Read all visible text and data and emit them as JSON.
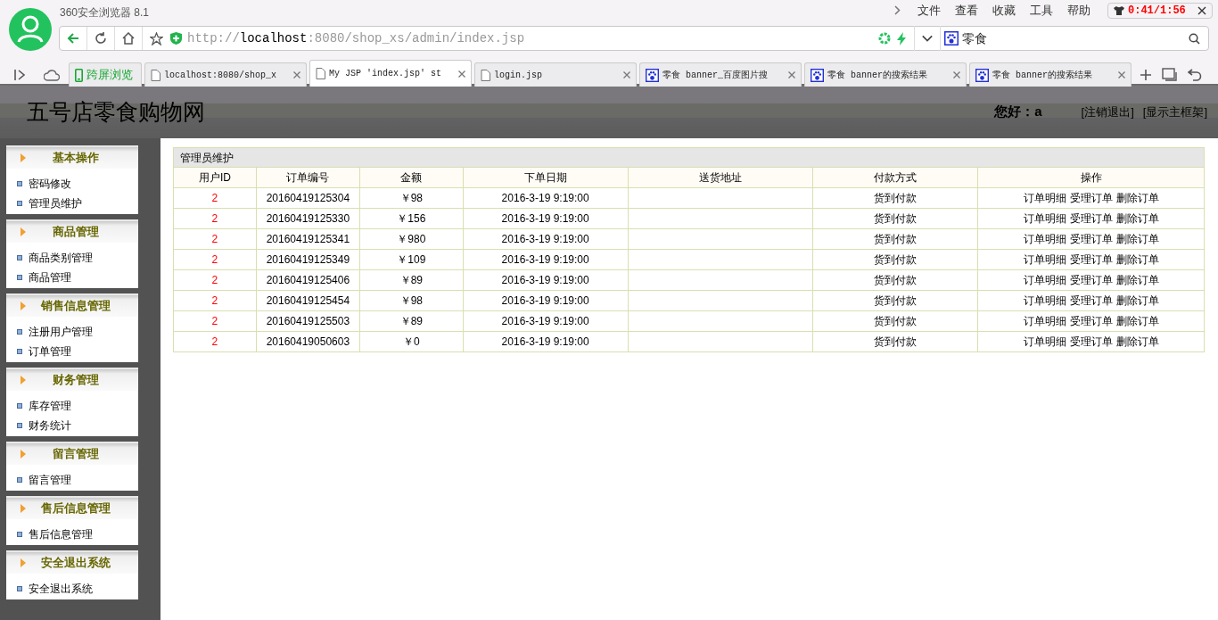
{
  "browser": {
    "app_title": "360安全浏览器 8.1",
    "menu": [
      "文件",
      "查看",
      "收藏",
      "工具",
      "帮助"
    ],
    "timer_overlay": "0:41/1:56",
    "address": {
      "scheme": "http://",
      "host": "localhost",
      "rest": ":8080/shop_xs/admin/index.jsp"
    },
    "search": {
      "value": "零食"
    },
    "tabs": [
      {
        "kind": "cross",
        "label": "跨屏浏览",
        "selected": false
      },
      {
        "kind": "page",
        "label": "localhost:8080/shop_x",
        "selected": false
      },
      {
        "kind": "page",
        "label": "My JSP 'index.jsp' st",
        "selected": true
      },
      {
        "kind": "page",
        "label": "login.jsp",
        "selected": false
      },
      {
        "kind": "paw",
        "label": "零食 banner_百度图片搜",
        "selected": false
      },
      {
        "kind": "paw",
        "label": "零食 banner的搜索结果",
        "selected": false
      },
      {
        "kind": "paw",
        "label": "零食 banner的搜索结果",
        "selected": false
      }
    ]
  },
  "header": {
    "site_title": "五号店零食购物网",
    "greeting": "您好：a",
    "links": [
      "[注销退出]",
      "[显示主框架]"
    ]
  },
  "sidebar": [
    {
      "title": "基本操作",
      "items": [
        "密码修改",
        "管理员维护"
      ]
    },
    {
      "title": "商品管理",
      "items": [
        "商品类别管理",
        "商品管理"
      ]
    },
    {
      "title": "销售信息管理",
      "items": [
        "注册用户管理",
        "订单管理"
      ]
    },
    {
      "title": "财务管理",
      "items": [
        "库存管理",
        "财务统计"
      ]
    },
    {
      "title": "留言管理",
      "items": [
        "留言管理"
      ]
    },
    {
      "title": "售后信息管理",
      "items": [
        "售后信息管理"
      ]
    },
    {
      "title": "安全退出系统",
      "items": [
        "安全退出系统"
      ]
    }
  ],
  "table": {
    "title": "管理员维护",
    "columns": [
      "用户ID",
      "订单编号",
      "金额",
      "下单日期",
      "送货地址",
      "付款方式",
      "操作"
    ],
    "rows": [
      {
        "user_id": "2",
        "order_no": "20160419125304",
        "amount": "￥98",
        "date": "2016-3-19 9:19:00",
        "payment": "货到付款",
        "actions": [
          "订单明细",
          "受理订单",
          "删除订单"
        ]
      },
      {
        "user_id": "2",
        "order_no": "20160419125330",
        "amount": "￥156",
        "date": "2016-3-19 9:19:00",
        "payment": "货到付款",
        "actions": [
          "订单明细",
          "受理订单",
          "删除订单"
        ]
      },
      {
        "user_id": "2",
        "order_no": "20160419125341",
        "amount": "￥980",
        "date": "2016-3-19 9:19:00",
        "payment": "货到付款",
        "actions": [
          "订单明细",
          "受理订单",
          "删除订单"
        ]
      },
      {
        "user_id": "2",
        "order_no": "20160419125349",
        "amount": "￥109",
        "date": "2016-3-19 9:19:00",
        "payment": "货到付款",
        "actions": [
          "订单明细",
          "受理订单",
          "删除订单"
        ]
      },
      {
        "user_id": "2",
        "order_no": "20160419125406",
        "amount": "￥89",
        "date": "2016-3-19 9:19:00",
        "payment": "货到付款",
        "actions": [
          "订单明细",
          "受理订单",
          "删除订单"
        ]
      },
      {
        "user_id": "2",
        "order_no": "20160419125454",
        "amount": "￥98",
        "date": "2016-3-19 9:19:00",
        "payment": "货到付款",
        "actions": [
          "订单明细",
          "受理订单",
          "删除订单"
        ]
      },
      {
        "user_id": "2",
        "order_no": "20160419125503",
        "amount": "￥89",
        "date": "2016-3-19 9:19:00",
        "payment": "货到付款",
        "actions": [
          "订单明细",
          "受理订单",
          "删除订单"
        ]
      },
      {
        "user_id": "2",
        "order_no": "20160419050603",
        "amount": "￥0",
        "date": "2016-3-19 9:19:00",
        "payment": "货到付款",
        "actions": [
          "订单明细",
          "受理订单",
          "删除订单"
        ]
      }
    ]
  }
}
